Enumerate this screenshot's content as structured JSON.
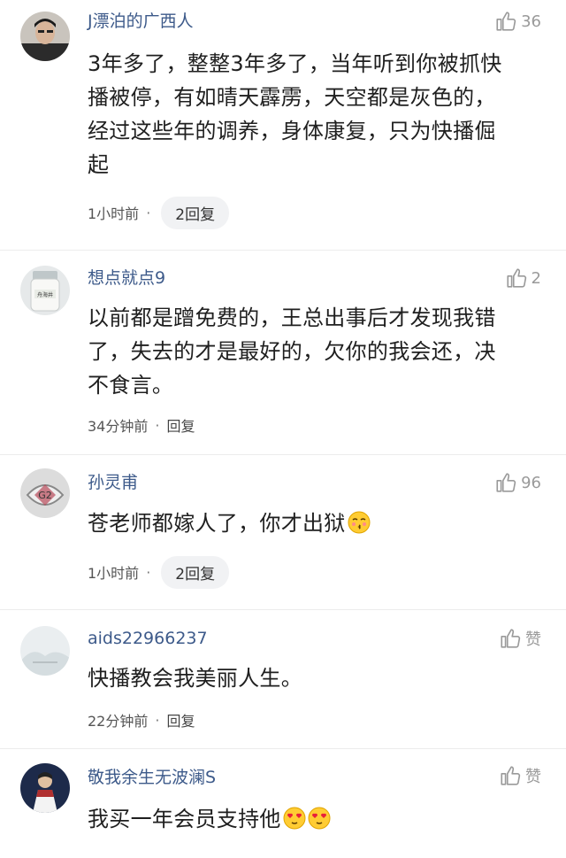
{
  "comments": [
    {
      "username": "J漂泊的广西人",
      "likes": "36",
      "text_lines": [
        "3年多了，整整3年多了，当年听到你被抓快",
        "播被停，有如晴天霹雳，天空都是灰色的，",
        "经过这些年的调养，身体康复，只为快播倔",
        "起"
      ],
      "time": "1小时前",
      "replies": "2回复"
    },
    {
      "username": "想点就点9",
      "likes": "2",
      "text_lines": [
        "以前都是蹭免费的，王总出事后才发现我错",
        "了，失去的才是最好的，欠你的我会还，决",
        "不食言。"
      ],
      "time": "34分钟前",
      "replies": "回复"
    },
    {
      "username": "孙灵甫",
      "likes": "96",
      "text_lines": [
        "苍老师都嫁人了，你才出狱"
      ],
      "time": "1小时前",
      "replies": "2回复"
    },
    {
      "username": "aids22966237",
      "likes": "赞",
      "text_lines": [
        "快播教会我美丽人生。"
      ],
      "time": "22分钟前",
      "replies": "回复"
    },
    {
      "username": "敬我余生无波澜S",
      "likes": "赞",
      "text_lines": [
        "我买一年会员支持他"
      ],
      "time": "",
      "replies": ""
    }
  ],
  "separator": "·",
  "icons": {
    "like": "thumbs-up-icon",
    "emoji_kiss": "kissing-face-emoji",
    "emoji_heart_eyes": "heart-eyes-emoji"
  },
  "colors": {
    "username": "#3d5a8a",
    "muted": "#9a9a9a",
    "pill_bg": "#f1f2f4"
  }
}
